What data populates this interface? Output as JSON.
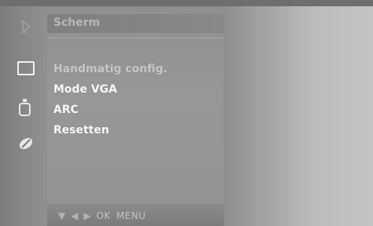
{
  "menu": {
    "title": "Scherm",
    "items": [
      {
        "label": "Handmatig config."
      },
      {
        "label": "Mode VGA"
      },
      {
        "label": "ARC"
      },
      {
        "label": "Resetten"
      }
    ]
  },
  "footer": {
    "ok_label": "OK",
    "menu_label": "MENU"
  },
  "sidebar": {
    "icons": [
      {
        "name": "input-icon"
      },
      {
        "name": "screen-icon"
      },
      {
        "name": "audio-icon"
      },
      {
        "name": "option-icon"
      }
    ]
  },
  "colors": {
    "panel_bg": "#939393",
    "title_bar": "#808080",
    "text_active": "#ffffff",
    "text_disabled": "#c7c7c7"
  }
}
